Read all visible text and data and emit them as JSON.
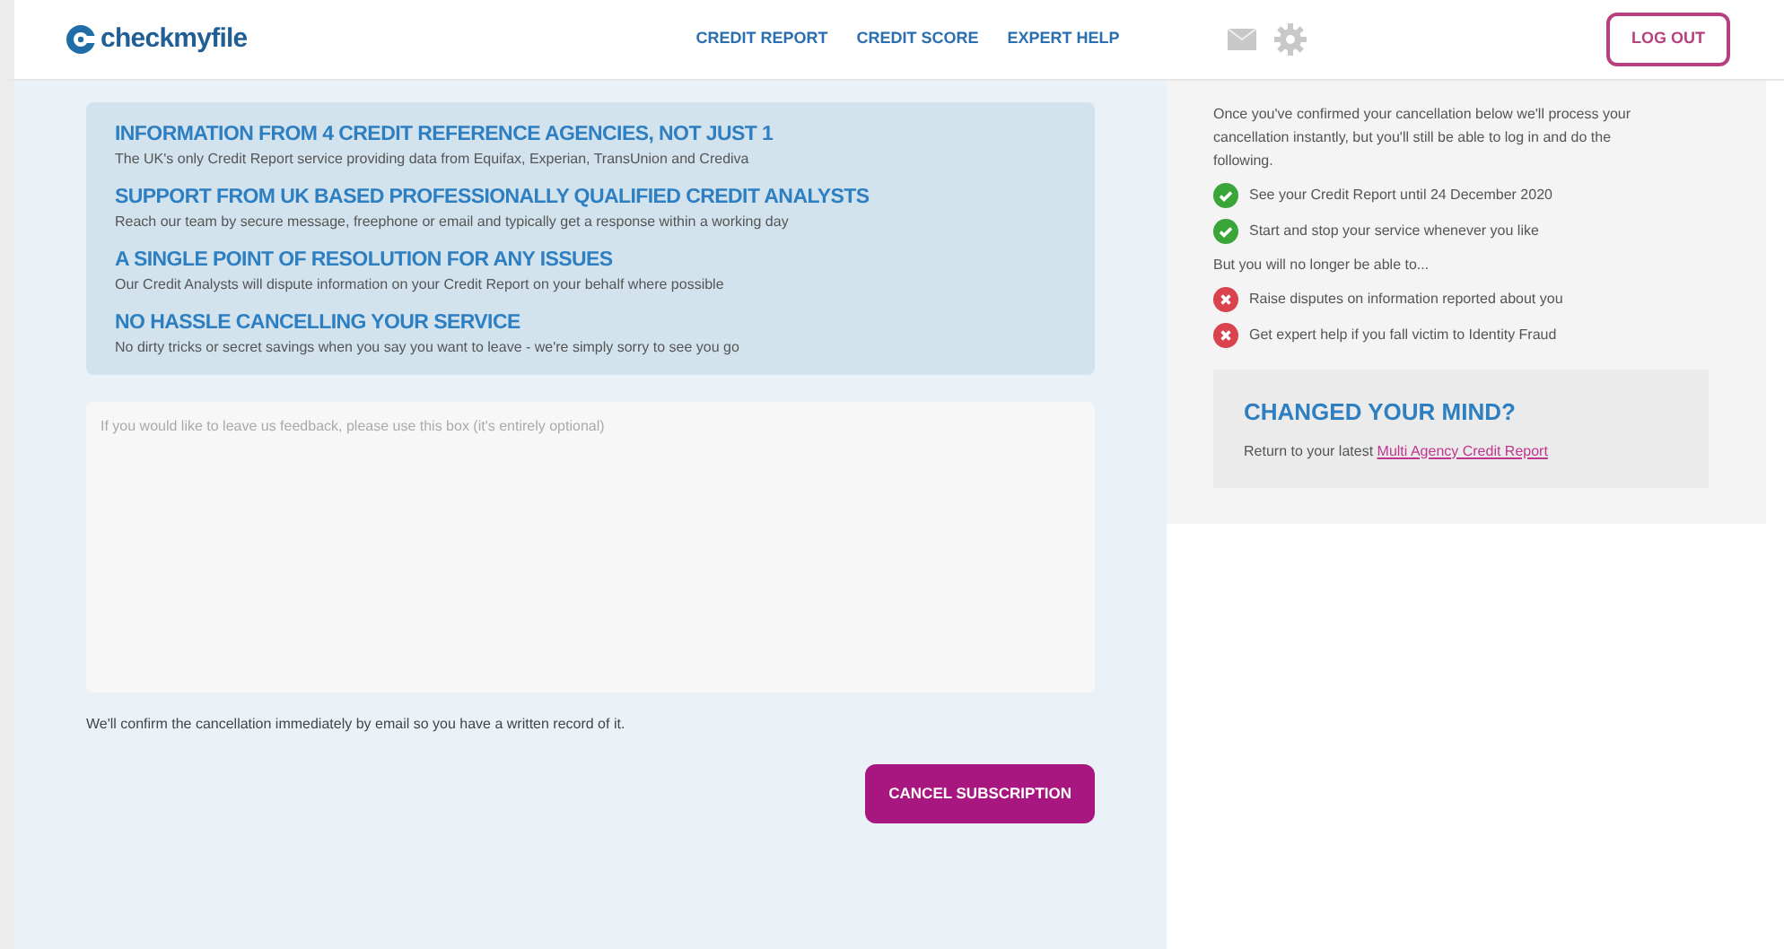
{
  "header": {
    "logo": "checkmyfile",
    "nav": [
      "CREDIT REPORT",
      "CREDIT SCORE",
      "EXPERT HELP"
    ],
    "logout": "LOG OUT"
  },
  "benefits": [
    {
      "title": "INFORMATION FROM 4 CREDIT REFERENCE AGENCIES, NOT JUST 1",
      "text": "The UK's only Credit Report service providing data from Equifax, Experian, TransUnion and Crediva"
    },
    {
      "title": "SUPPORT FROM UK BASED PROFESSIONALLY QUALIFIED CREDIT ANALYSTS",
      "text": "Reach our team by secure message, freephone or email and typically get a response within a working day"
    },
    {
      "title": "A SINGLE POINT OF RESOLUTION FOR ANY ISSUES",
      "text": "Our Credit Analysts will dispute information on your Credit Report on your behalf where possible"
    },
    {
      "title": "NO HASSLE CANCELLING YOUR SERVICE",
      "text": "No dirty tricks or secret savings when you say you want to leave - we're simply sorry to see you go"
    }
  ],
  "feedback": {
    "placeholder": "If you would like to leave us feedback, please use this box (it's entirely optional)"
  },
  "confirm_note": "We'll confirm the cancellation immediately by email so you have a written record of it.",
  "cancel_button": "CANCEL SUBSCRIPTION",
  "sidebar": {
    "intro": "Once you've confirmed your cancellation below we'll process your cancellation instantly, but you'll still be able to log in and do the following.",
    "items": [
      {
        "kind": "yes",
        "text": "See your Credit Report until 24 December 2020"
      },
      {
        "kind": "yes",
        "text": "Start and stop your service whenever you like"
      },
      {
        "kind": "note",
        "text": "But you will no longer be able to..."
      },
      {
        "kind": "no",
        "text": "Raise disputes on information reported about you"
      },
      {
        "kind": "no",
        "text": "Get expert help if you fall victim to Identity Fraud"
      }
    ],
    "changed": {
      "title": "CHANGED YOUR MIND?",
      "text": "Return to your latest",
      "link": "Multi Agency Credit Report"
    }
  }
}
